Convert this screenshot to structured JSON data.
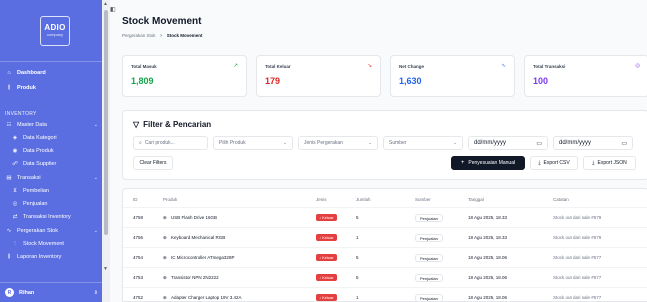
{
  "sidebar": {
    "logo_text": "ADIO",
    "logo_sub": "company",
    "dashboard": "Dashboard",
    "produk": "Produk",
    "section_inventory": "INVENTORY",
    "master_data": "Master Data",
    "data_kategori": "Data Kategori",
    "data_produk": "Data Produk",
    "data_supplier": "Data Supplier",
    "transaksi": "Transaksi",
    "pembelian": "Pembelian",
    "penjualan": "Penjualan",
    "transaksi_inventory": "Transaksi Inventory",
    "pergerakan_stok": "Pergerakan Stok",
    "stock_movement": "Stock Movement",
    "laporan_inventory": "Laporan Inventory",
    "user_initial": "R",
    "user_name": "Rihan"
  },
  "header": {
    "title": "Stock Movement",
    "crumb_parent": "Pergerakan Stok",
    "crumb_sep": ">",
    "crumb_current": "Stock Movement"
  },
  "stats": [
    {
      "label": "Total Masuk",
      "value": "1,809",
      "color": "#16a34a",
      "icon": "↗",
      "icon_color": "#16a34a"
    },
    {
      "label": "Total Keluar",
      "value": "179",
      "color": "#dc2626",
      "icon": "↘",
      "icon_color": "#dc2626"
    },
    {
      "label": "Net Change",
      "value": "1,630",
      "color": "#2563eb",
      "icon": "∿",
      "icon_color": "#3b82f6"
    },
    {
      "label": "Total Transaksi",
      "value": "100",
      "color": "#7c3aed",
      "icon": "◎",
      "icon_color": "#7c3aed"
    }
  ],
  "filter": {
    "title": "Filter & Pencarian",
    "search_placeholder": "Cari produk...",
    "produk_placeholder": "Pilih Produk",
    "jenis_placeholder": "Jenis Pergerakan",
    "sumber_placeholder": "Sumber",
    "date_from": "dd/mm/yyyy",
    "date_to": "dd/mm/yyyy",
    "clear_label": "Clear Filters",
    "manual_label": "Penyesuaian Manual",
    "export_csv": "Export CSV",
    "export_json": "Export JSON"
  },
  "table": {
    "columns": [
      "ID",
      "Produk",
      "Jenis",
      "Jumlah",
      "Sumber",
      "Tanggal",
      "Catatan"
    ],
    "rows": [
      {
        "id": "4758",
        "produk": "USB Flash Drive 16GB",
        "jenis": "Keluar",
        "jumlah": "5",
        "sumber": "Penjualan",
        "tanggal": "18 Agu 2025, 18.33",
        "catatan": "Stock out dari sale #579"
      },
      {
        "id": "4756",
        "produk": "Keyboard Mechanical RGB",
        "jenis": "Keluar",
        "jumlah": "1",
        "sumber": "Penjualan",
        "tanggal": "18 Agu 2025, 18.33",
        "catatan": "Stock out dari sale #579"
      },
      {
        "id": "4754",
        "produk": "IC Microcontroller ATmega328P",
        "jenis": "Keluar",
        "jumlah": "5",
        "sumber": "Penjualan",
        "tanggal": "18 Agu 2025, 18.06",
        "catatan": "Stock out dari sale #577"
      },
      {
        "id": "4753",
        "produk": "Transistor NPN 2N2222",
        "jenis": "Keluar",
        "jumlah": "5",
        "sumber": "Penjualan",
        "tanggal": "18 Agu 2025, 18.06",
        "catatan": "Stock out dari sale #577"
      },
      {
        "id": "4752",
        "produk": "Adapter Charger Laptop 19V 3.42A",
        "jenis": "Keluar",
        "jumlah": "1",
        "sumber": "Penjualan",
        "tanggal": "18 Agu 2025, 18.06",
        "catatan": "Stock out dari sale #577"
      }
    ]
  },
  "colors": {
    "sidebar": "#5b6ee1",
    "badge_keluar": "#e53e3e",
    "button_dark": "#111827"
  }
}
